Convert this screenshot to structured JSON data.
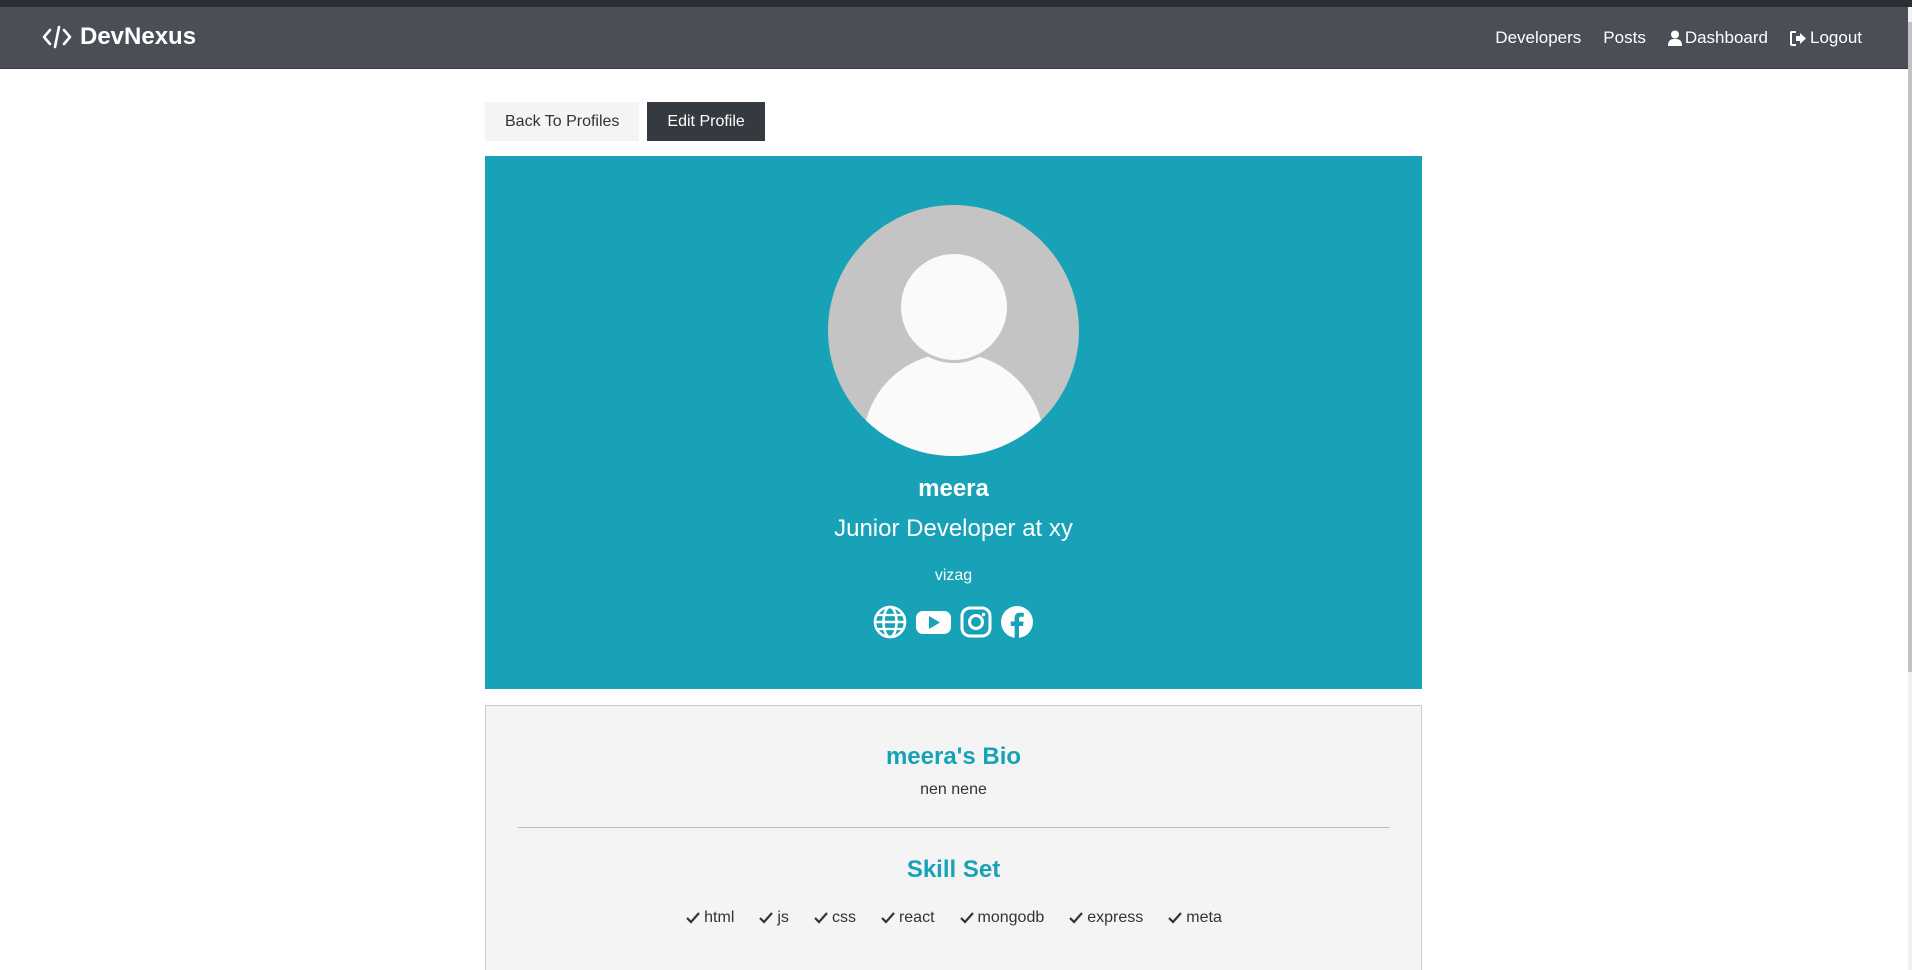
{
  "navbar": {
    "brand": "DevNexus",
    "links": {
      "developers": "Developers",
      "posts": "Posts",
      "dashboard": "Dashboard",
      "logout": "Logout"
    }
  },
  "actions": {
    "back": "Back To Profiles",
    "edit": "Edit Profile"
  },
  "profile": {
    "name": "meera",
    "status": "Junior Developer at xy",
    "location": "vizag",
    "social_icons": [
      "globe-icon",
      "youtube-icon",
      "instagram-icon",
      "facebook-icon"
    ]
  },
  "about": {
    "bio_title": "meera's Bio",
    "bio": "nen nene",
    "skills_title": "Skill Set",
    "skills": [
      "html",
      "js",
      "css",
      "react",
      "mongodb",
      "express",
      "meta"
    ]
  },
  "colors": {
    "navbar": "#4a4f57",
    "primary": "#17a2b8",
    "dark_button": "#343a40",
    "light_bg": "#f4f4f4"
  }
}
